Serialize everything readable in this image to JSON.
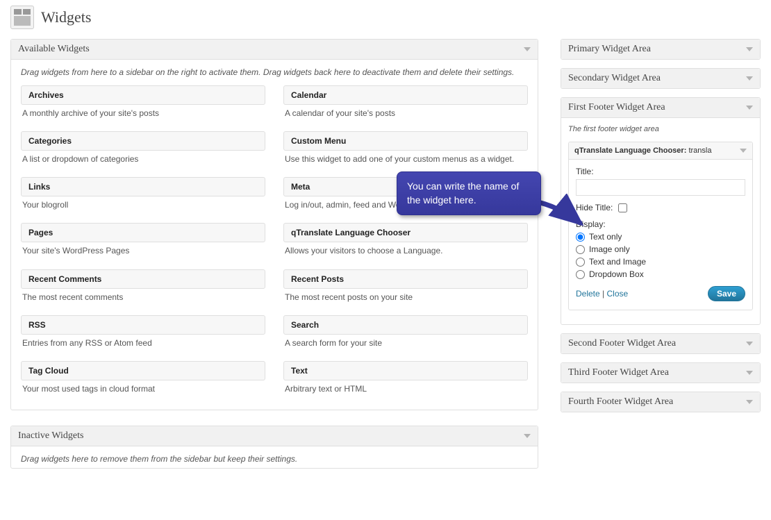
{
  "header": {
    "title": "Widgets"
  },
  "available": {
    "panel_title": "Available Widgets",
    "description": "Drag widgets from here to a sidebar on the right to activate them. Drag widgets back here to deactivate them and delete their settings.",
    "widgets": [
      {
        "name": "Archives",
        "desc": "A monthly archive of your site's posts"
      },
      {
        "name": "Calendar",
        "desc": "A calendar of your site's posts"
      },
      {
        "name": "Categories",
        "desc": "A list or dropdown of categories"
      },
      {
        "name": "Custom Menu",
        "desc": "Use this widget to add one of your custom menus as a widget."
      },
      {
        "name": "Links",
        "desc": "Your blogroll"
      },
      {
        "name": "Meta",
        "desc": "Log in/out, admin, feed and WordPress links"
      },
      {
        "name": "Pages",
        "desc": "Your site's WordPress Pages"
      },
      {
        "name": "qTranslate Language Chooser",
        "desc": "Allows your visitors to choose a Language."
      },
      {
        "name": "Recent Comments",
        "desc": "The most recent comments"
      },
      {
        "name": "Recent Posts",
        "desc": "The most recent posts on your site"
      },
      {
        "name": "RSS",
        "desc": "Entries from any RSS or Atom feed"
      },
      {
        "name": "Search",
        "desc": "A search form for your site"
      },
      {
        "name": "Tag Cloud",
        "desc": "Your most used tags in cloud format"
      },
      {
        "name": "Text",
        "desc": "Arbitrary text or HTML"
      }
    ]
  },
  "inactive": {
    "panel_title": "Inactive Widgets",
    "description": "Drag widgets here to remove them from the sidebar but keep their settings."
  },
  "sidebars": {
    "primary": {
      "title": "Primary Widget Area"
    },
    "secondary": {
      "title": "Secondary Widget Area"
    },
    "first_footer": {
      "title": "First Footer Widget Area",
      "description": "The first footer widget area",
      "widget": {
        "head_name": "qTranslate Language Chooser:",
        "head_instance": "transla",
        "title_label": "Title:",
        "title_value": "",
        "hide_title_label": "Hide Title:",
        "hide_title_checked": false,
        "display_label": "Display:",
        "options": {
          "text_only": "Text only",
          "image_only": "Image only",
          "text_image": "Text and Image",
          "dropdown": "Dropdown Box"
        },
        "selected_option": "text_only",
        "delete_label": "Delete",
        "close_label": "Close",
        "save_label": "Save"
      }
    },
    "second_footer": {
      "title": "Second Footer Widget Area"
    },
    "third_footer": {
      "title": "Third Footer Widget Area"
    },
    "fourth_footer": {
      "title": "Fourth Footer Widget Area"
    }
  },
  "callout": {
    "text": "You can write the name of the widget here."
  }
}
